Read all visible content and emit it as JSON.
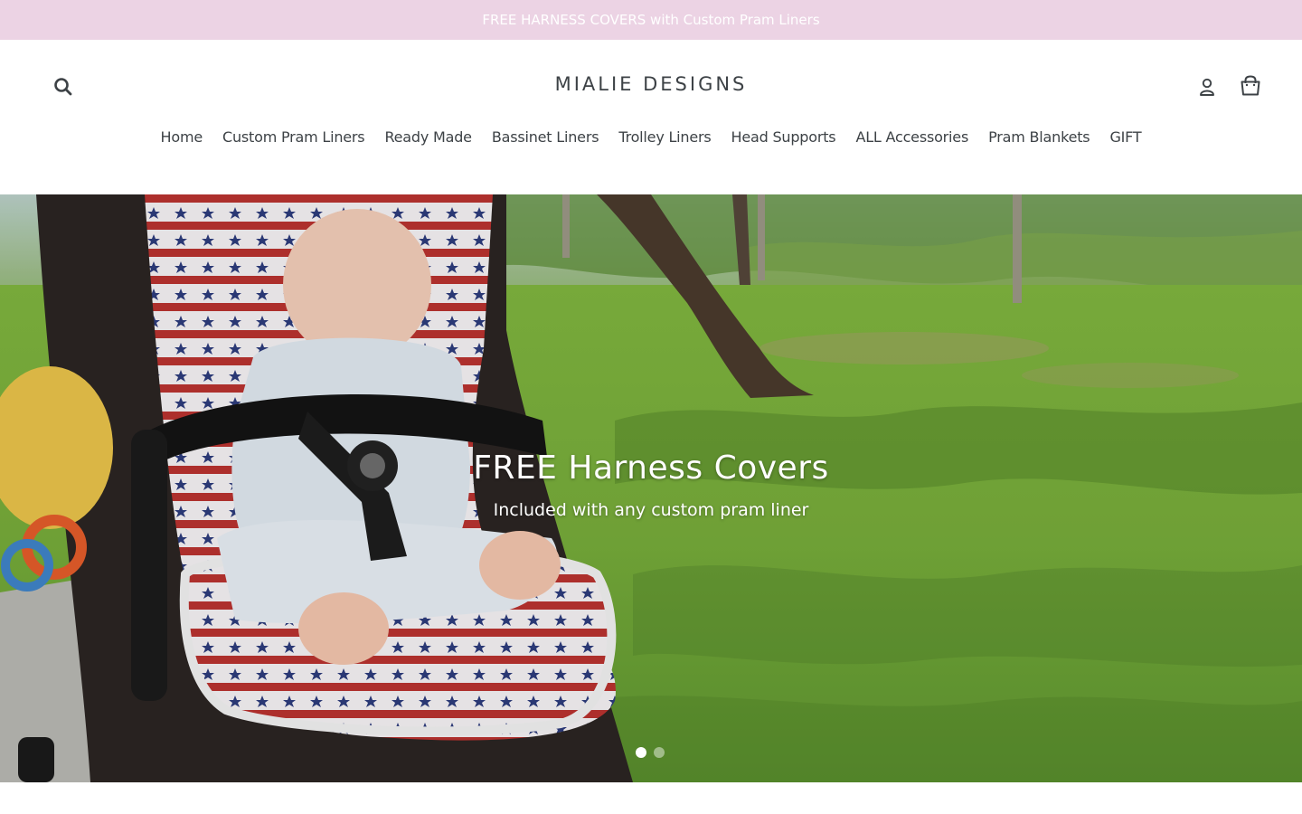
{
  "announcement": {
    "text": "FREE HARNESS COVERS with Custom Pram Liners"
  },
  "header": {
    "logo": "MIALIE DESIGNS",
    "icons": {
      "search": "search-icon",
      "login": "user-icon",
      "cart": "cart-icon"
    }
  },
  "nav": {
    "items": [
      {
        "label": "Home"
      },
      {
        "label": "Custom Pram Liners"
      },
      {
        "label": "Ready Made"
      },
      {
        "label": "Bassinet Liners"
      },
      {
        "label": "Trolley Liners"
      },
      {
        "label": "Head Supports"
      },
      {
        "label": "ALL Accessories"
      },
      {
        "label": "Pram Blankets"
      },
      {
        "label": "GIFT"
      }
    ]
  },
  "hero": {
    "title": "FREE Harness Covers",
    "subtitle": "Included with any custom pram liner",
    "slides": {
      "count": 2,
      "active": 1
    }
  },
  "colors": {
    "announcement_bg": "#ecd3e4",
    "text": "#3d4246",
    "hero_text": "#ffffff"
  }
}
